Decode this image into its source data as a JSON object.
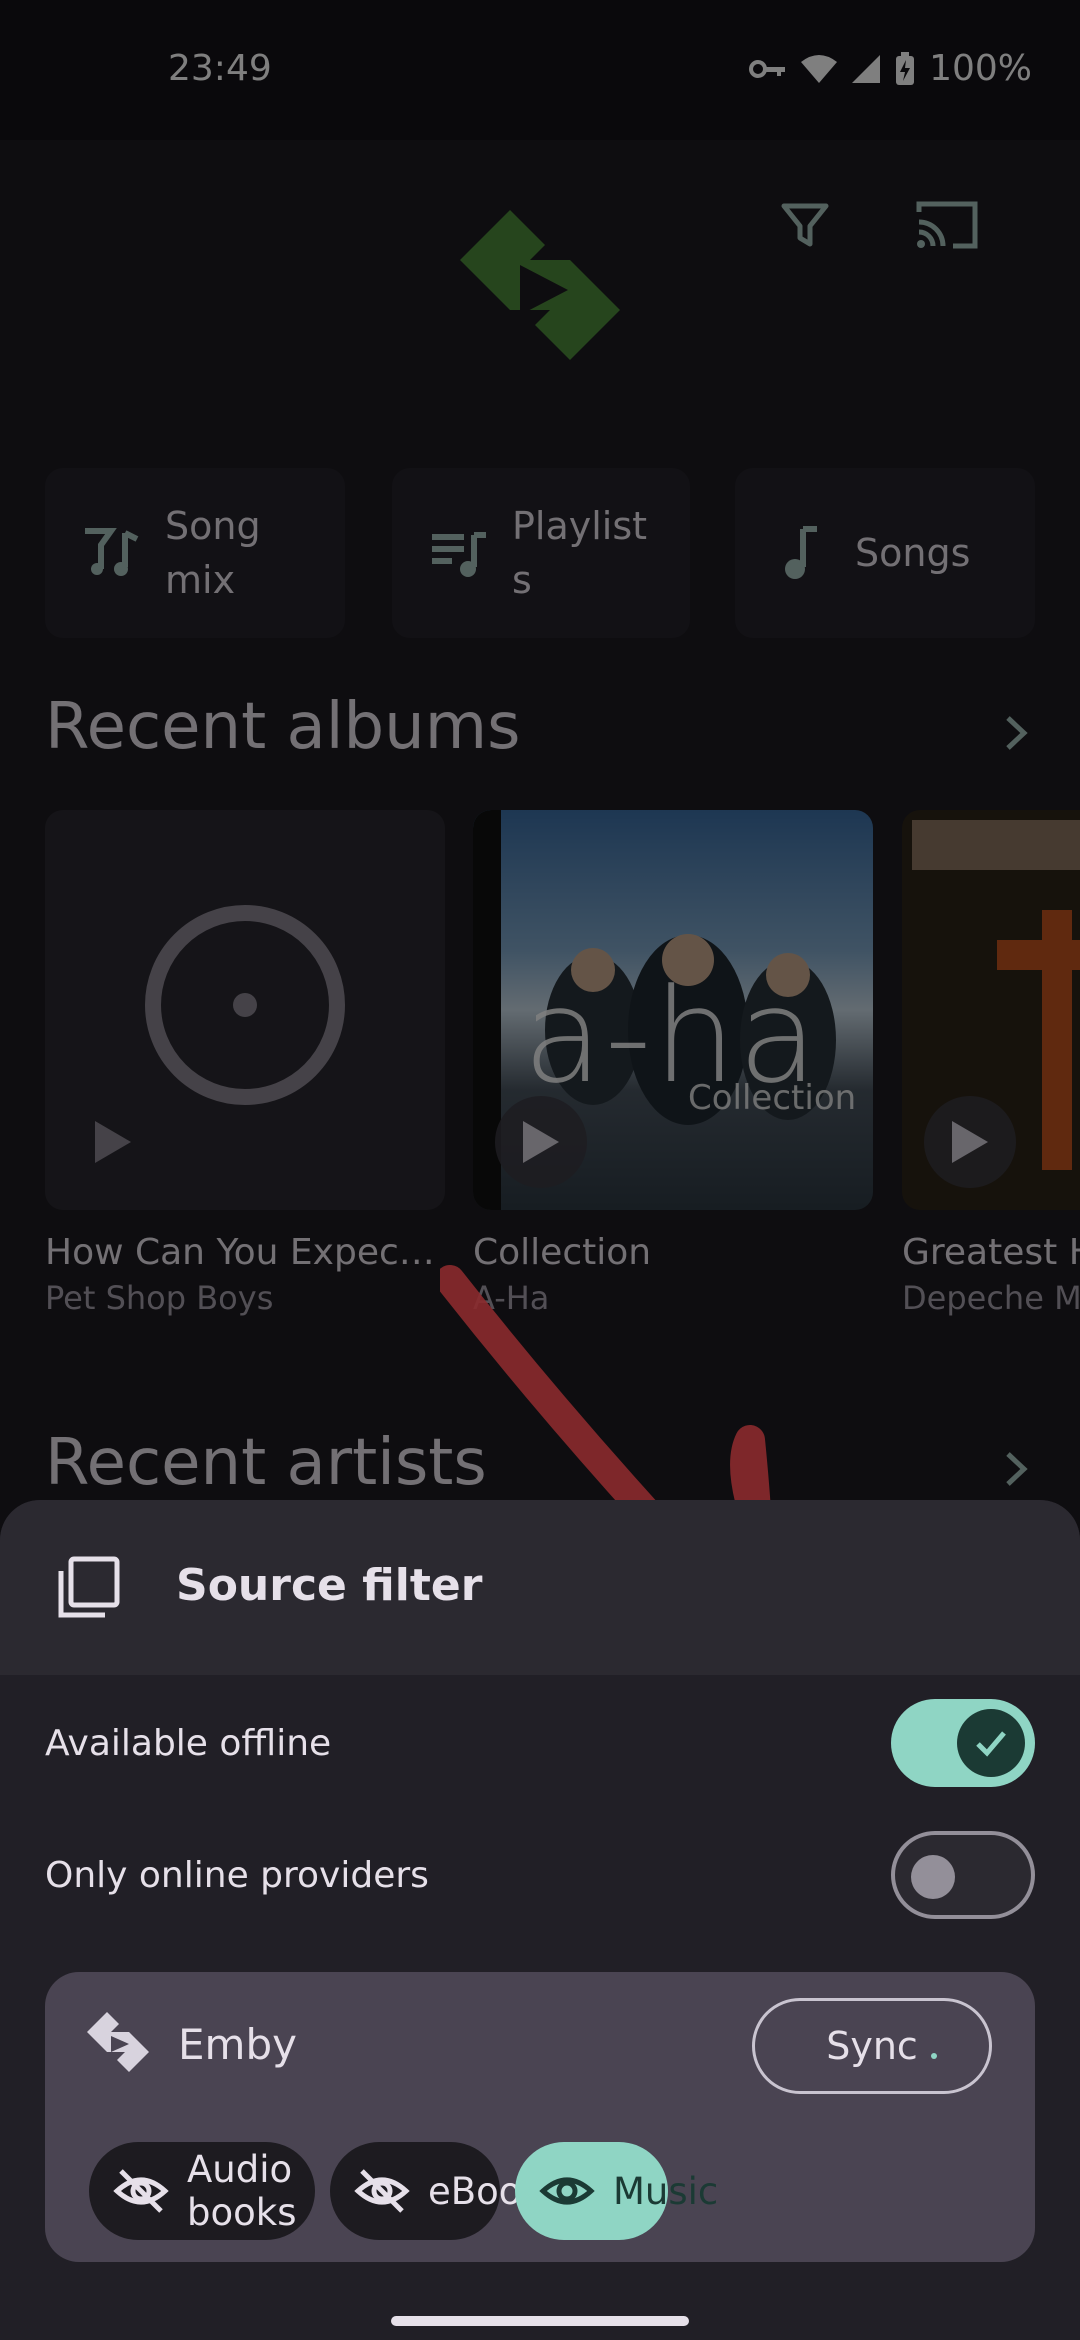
{
  "status_bar": {
    "time": "23:49",
    "battery": "100%"
  },
  "home": {
    "quick_chips": [
      {
        "label": "Song\nmix",
        "icon": "song-mix-icon"
      },
      {
        "label": "Playlist\ns",
        "icon": "playlist-icon"
      },
      {
        "label": "Songs",
        "icon": "music-note-icon"
      }
    ],
    "recent_albums_title": "Recent albums",
    "recent_artists_title": "Recent artists",
    "albums": [
      {
        "title": "How Can You Expect …",
        "artist": "Pet Shop Boys",
        "art": "placeholder-disc"
      },
      {
        "title": "Collection",
        "artist": "A-Ha",
        "art_text": "a-ha",
        "art_subtext": "Collection"
      },
      {
        "title": "Greatest H",
        "artist": "Depeche Mo"
      }
    ]
  },
  "sheet": {
    "title": "Source filter",
    "toggles": [
      {
        "label": "Available offline",
        "checked": true
      },
      {
        "label": "Only online providers",
        "checked": false
      }
    ],
    "provider": {
      "name": "Emby",
      "sync_label": "Sync",
      "filters": [
        {
          "label": "Audio books",
          "active": false,
          "icon": "eye-off-icon"
        },
        {
          "label": "eBooks",
          "active": false,
          "icon": "eye-off-icon"
        },
        {
          "label": "Music",
          "active": true,
          "icon": "eye-icon"
        }
      ]
    }
  },
  "colors": {
    "accent": "#8fd5c4",
    "logo_green": "#4d8b3a",
    "annotation_red": "#8b2a2e"
  }
}
